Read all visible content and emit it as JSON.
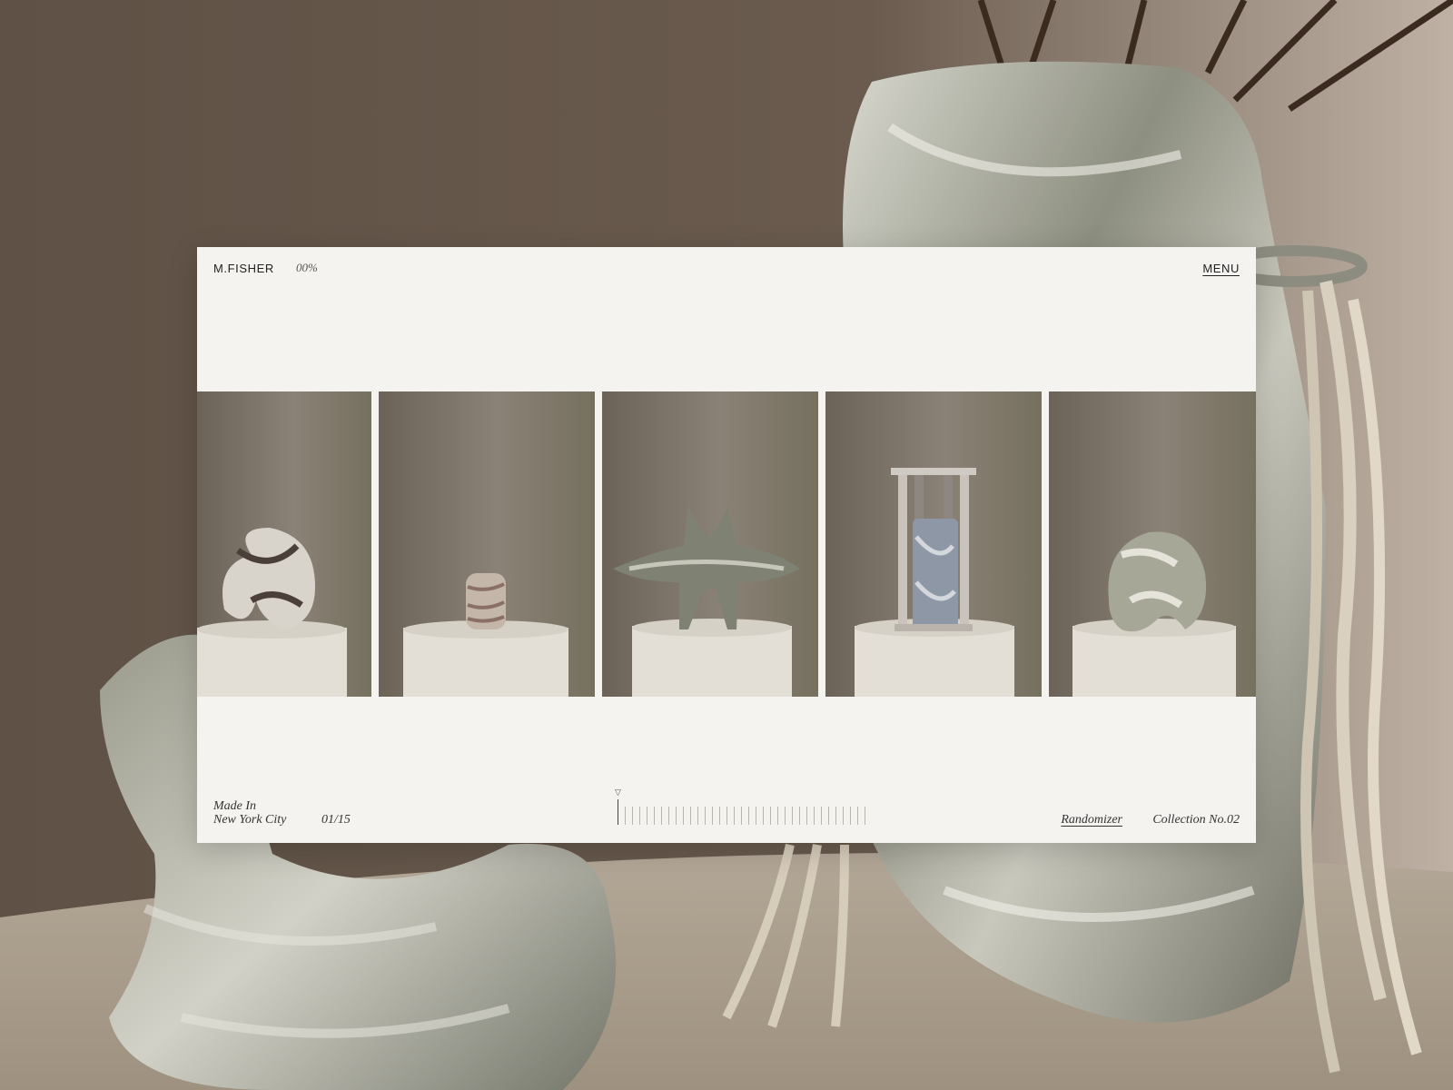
{
  "header": {
    "brand": "M.FISHER",
    "progress_label": "00%",
    "menu_label": "MENU"
  },
  "gallery": {
    "items": [
      {
        "name": "twisted-marble-sculpture"
      },
      {
        "name": "small-marble-cylinder"
      },
      {
        "name": "winged-marble-sculpture"
      },
      {
        "name": "marble-column-sculpture"
      },
      {
        "name": "curled-marble-sculpture"
      }
    ]
  },
  "footer": {
    "made_in_line1": "Made In",
    "made_in_line2": "New York City",
    "counter": "01/15",
    "scrubber_total_ticks": 35,
    "scrubber_active_index": 0,
    "randomizer_label": "Randomizer",
    "collection_label": "Collection No.02"
  },
  "colors": {
    "background": "#65564a",
    "window": "#f4f3f0",
    "text": "#222222"
  }
}
